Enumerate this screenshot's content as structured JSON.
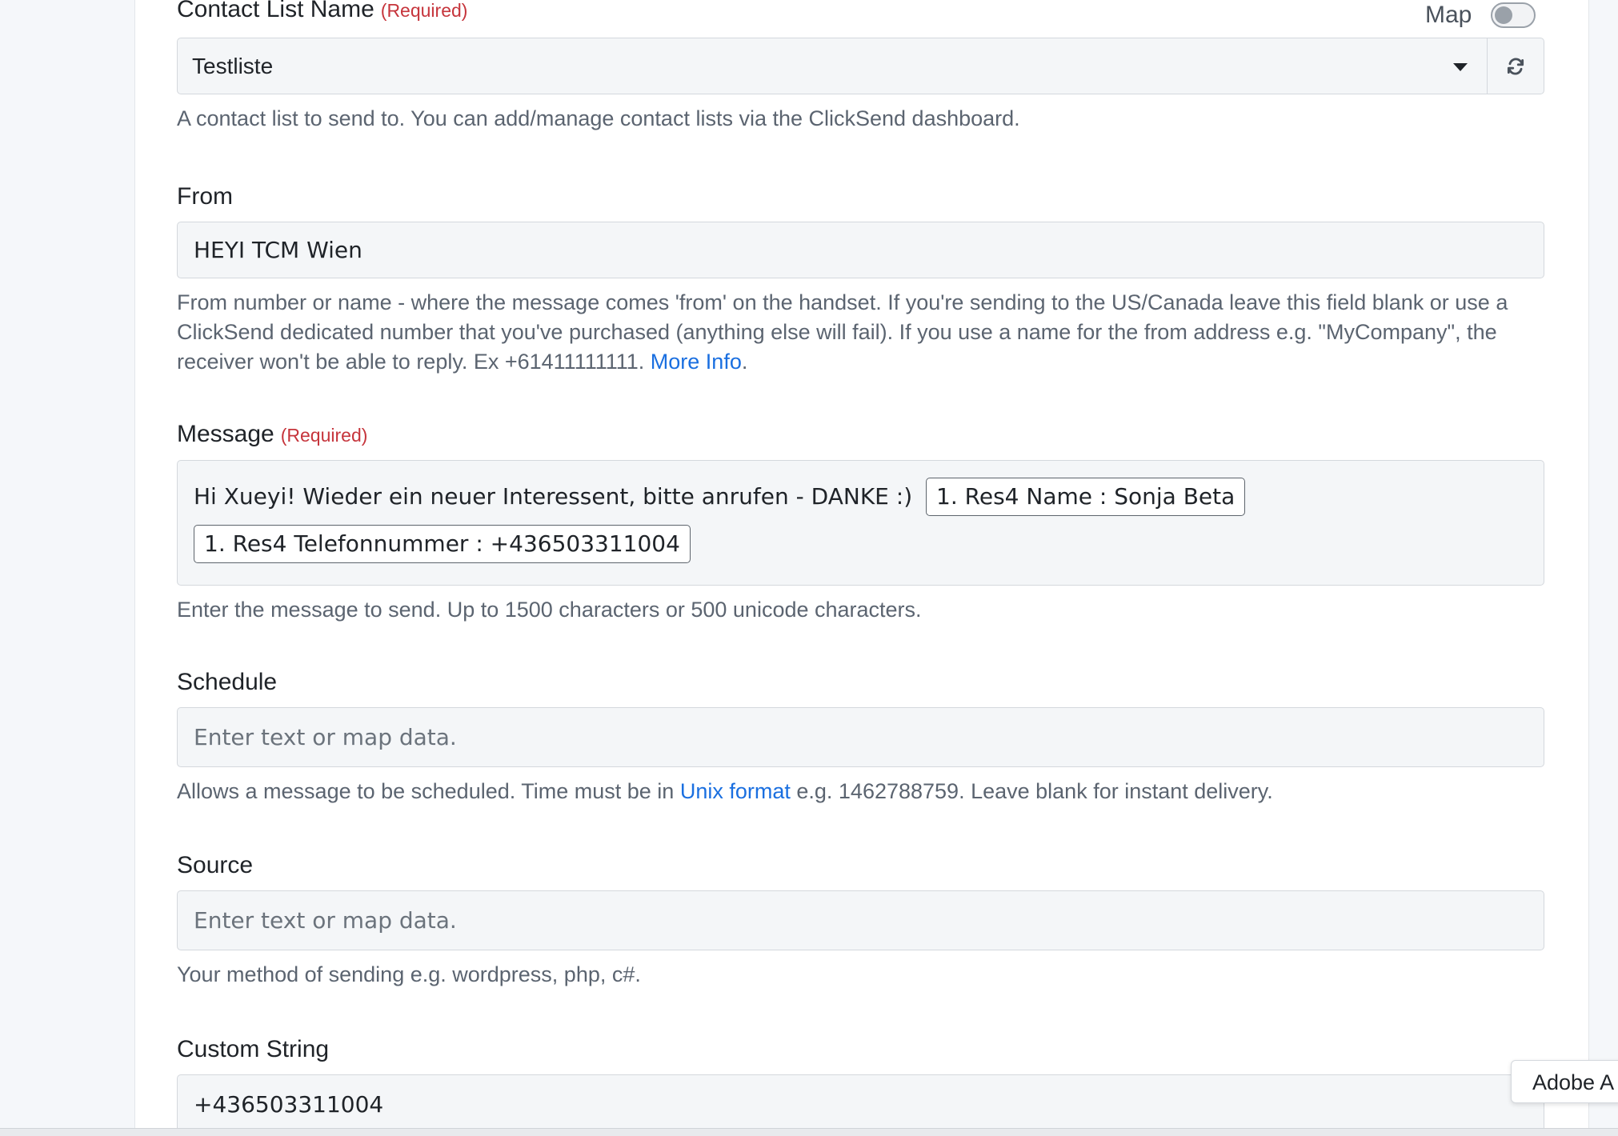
{
  "map_toggle": {
    "label": "Map",
    "on": false
  },
  "contact_list": {
    "label": "Contact List Name",
    "required": "(Required)",
    "value": "Testliste",
    "hint": "A contact list to send to. You can add/manage contact lists via the ClickSend dashboard."
  },
  "from": {
    "label": "From",
    "value": "HEYI TCM Wien",
    "hint_text": "From number or name - where the message comes 'from' on the handset. If you're sending to the US/Canada leave this field blank or use a ClickSend dedicated number that you've purchased (anything else will fail). If you use a name for the from address e.g. \"MyCompany\", the receiver won't be able to reply. Ex +61411111111. ",
    "hint_link": "More Info",
    "hint_end": "."
  },
  "message": {
    "label": "Message",
    "required": "(Required)",
    "text": "Hi Xueyi! Wieder ein neuer Interessent, bitte anrufen - DANKE :)",
    "pill1": "1. Res4 Name : Sonja Beta",
    "pill2": "1. Res4 Telefonnummer : +436503311004",
    "hint": "Enter the message to send. Up to 1500 characters or 500 unicode characters."
  },
  "schedule": {
    "label": "Schedule",
    "placeholder": "Enter text or map data.",
    "hint_pre": "Allows a message to be scheduled. Time must be in ",
    "hint_link": "Unix format",
    "hint_post": " e.g. 1462788759. Leave blank for instant delivery."
  },
  "source": {
    "label": "Source",
    "placeholder": "Enter text or map data.",
    "hint": "Your method of sending e.g. wordpress, php, c#."
  },
  "custom_string": {
    "label": "Custom String",
    "value": "+436503311004"
  },
  "adobe_tab": {
    "label": "Adobe A"
  },
  "colors": {
    "link": "#1a6fe0",
    "required": "#c6353c",
    "hint": "#5b6470"
  }
}
